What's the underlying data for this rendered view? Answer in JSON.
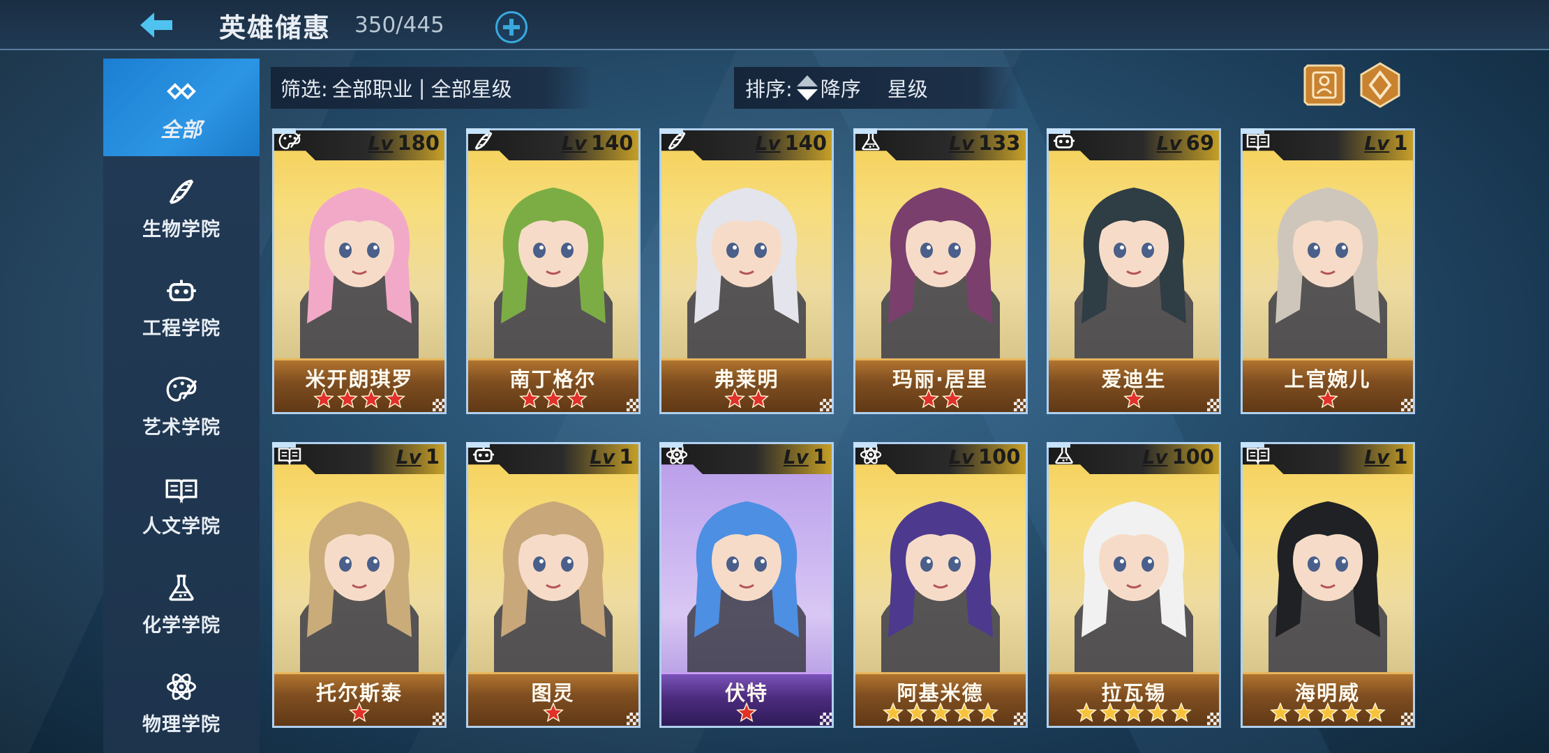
{
  "header": {
    "title": "英雄储惠",
    "count": "350/445"
  },
  "sidebar": {
    "items": [
      {
        "label": "全部",
        "icon": "infinity-icon",
        "active": true
      },
      {
        "label": "生物学院",
        "icon": "dna-icon"
      },
      {
        "label": "工程学院",
        "icon": "robot-icon"
      },
      {
        "label": "艺术学院",
        "icon": "palette-icon"
      },
      {
        "label": "人文学院",
        "icon": "book-icon"
      },
      {
        "label": "化学学院",
        "icon": "flask-icon"
      },
      {
        "label": "物理学院",
        "icon": "atom-icon"
      }
    ]
  },
  "filter": {
    "label": "筛选:",
    "profession": "全部职业",
    "separator": "|",
    "stars": "全部星级"
  },
  "sort": {
    "label": "排序:",
    "order": "降序",
    "field": "星级"
  },
  "level_prefix": "Lv",
  "heroes": [
    {
      "name": "米开朗琪罗",
      "level": "180",
      "stars": 4,
      "class_icon": "palette-icon",
      "hair": "#f2a9c8",
      "theme": "gold"
    },
    {
      "name": "南丁格尔",
      "level": "140",
      "stars": 3,
      "class_icon": "dna-icon",
      "hair": "#7cad45",
      "theme": "gold"
    },
    {
      "name": "弗莱明",
      "level": "140",
      "stars": 2,
      "class_icon": "dna-icon",
      "hair": "#e4e4ec",
      "theme": "gold"
    },
    {
      "name": "玛丽·居里",
      "level": "133",
      "stars": 2,
      "class_icon": "flask-icon",
      "hair": "#7b3f6e",
      "theme": "gold"
    },
    {
      "name": "爱迪生",
      "level": "69",
      "stars": 1,
      "class_icon": "robot-icon",
      "hair": "#2f3d44",
      "theme": "gold"
    },
    {
      "name": "上官婉儿",
      "level": "1",
      "stars": 1,
      "class_icon": "book-icon",
      "hair": "#cfc6bb",
      "theme": "gold"
    },
    {
      "name": "托尔斯泰",
      "level": "1",
      "stars": 1,
      "class_icon": "book-icon",
      "hair": "#c9ac7a",
      "theme": "gold"
    },
    {
      "name": "图灵",
      "level": "1",
      "stars": 1,
      "class_icon": "robot-icon",
      "hair": "#c8a77a",
      "theme": "gold"
    },
    {
      "name": "伏特",
      "level": "1",
      "stars": 1,
      "class_icon": "atom-icon",
      "hair": "#4d8fe3",
      "theme": "purple"
    },
    {
      "name": "阿基米德",
      "level": "100",
      "stars": 5,
      "class_icon": "atom-icon",
      "hair": "#4d3a8e",
      "theme": "gold"
    },
    {
      "name": "拉瓦锡",
      "level": "100",
      "stars": 5,
      "class_icon": "flask-icon",
      "hair": "#f1f1f1",
      "theme": "gold"
    },
    {
      "name": "海明威",
      "level": "1",
      "stars": 5,
      "class_icon": "book-icon",
      "hair": "#1f2124",
      "theme": "gold"
    }
  ],
  "colors": {
    "accent_blue": "#2c95e4",
    "star_red": "#e0312a",
    "star_gold": "#f7c23b"
  }
}
